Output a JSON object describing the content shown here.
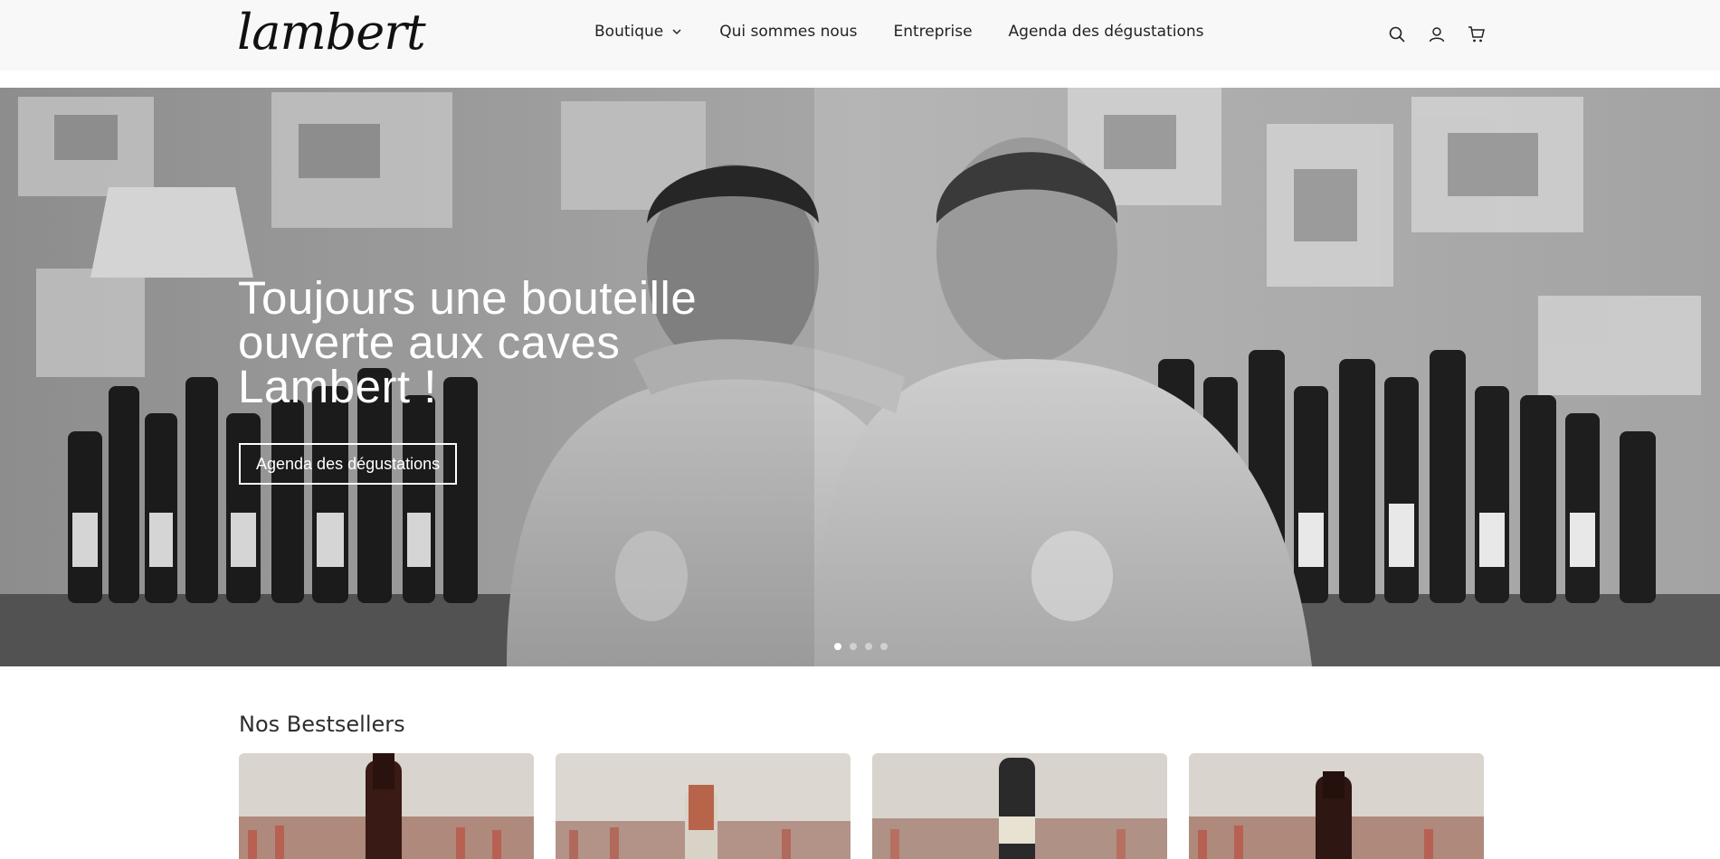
{
  "header": {
    "logo": "lambert",
    "nav": [
      {
        "label": "Boutique",
        "has_dropdown": true
      },
      {
        "label": "Qui sommes nous"
      },
      {
        "label": "Entreprise"
      },
      {
        "label": "Agenda des dégustations"
      }
    ],
    "icons": [
      "search-icon",
      "account-icon",
      "cart-icon"
    ]
  },
  "hero": {
    "title": "Toujours une bouteille ouverte aux caves Lambert !",
    "button_label": "Agenda des dégustations",
    "slides_total": 4,
    "active_slide": 1
  },
  "bestsellers": {
    "title": "Nos Bestsellers",
    "products": [
      {
        "image": "red-wine-bottle"
      },
      {
        "image": "orange-foil-bottle"
      },
      {
        "image": "white-wine-bottle"
      },
      {
        "image": "red-wine-bottle"
      }
    ]
  },
  "colors": {
    "header_bg": "#f8f8f8",
    "text": "#232323",
    "hero_text": "#ffffff"
  }
}
